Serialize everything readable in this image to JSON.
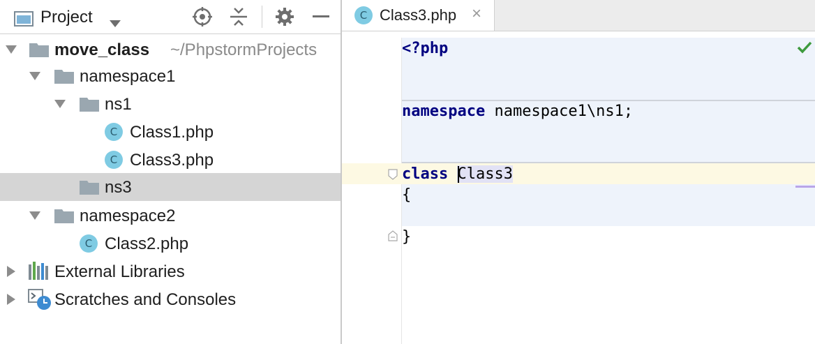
{
  "project_panel": {
    "title": "Project",
    "tree": [
      {
        "label": "move_class",
        "path": "~/PhpstormProjects",
        "type": "root-folder",
        "expanded": true
      },
      {
        "label": "namespace1",
        "type": "folder",
        "expanded": true
      },
      {
        "label": "ns1",
        "type": "folder",
        "expanded": true
      },
      {
        "label": "Class1.php",
        "type": "php-class"
      },
      {
        "label": "Class3.php",
        "type": "php-class"
      },
      {
        "label": "ns3",
        "type": "folder",
        "selected": true
      },
      {
        "label": "namespace2",
        "type": "folder",
        "expanded": true
      },
      {
        "label": "Class2.php",
        "type": "php-class"
      },
      {
        "label": "External Libraries",
        "type": "libraries",
        "expanded": false
      },
      {
        "label": "Scratches and Consoles",
        "type": "scratches",
        "expanded": false
      }
    ],
    "class_icon_letter": "C"
  },
  "editor": {
    "tab": {
      "label": "Class3.php",
      "close": "×"
    },
    "code": {
      "php_open": "<?php",
      "namespace_kw": "namespace",
      "namespace_value": " namespace1\\ns1;",
      "class_kw": "class",
      "class_name": "Class3",
      "open_brace": "{",
      "close_brace": "}"
    }
  },
  "colors": {
    "selection": "#d5d5d5",
    "keyword": "#000080",
    "class_icon": "#7fcbe3",
    "caret_row": "#fdf9e3",
    "check": "#3d9a3d"
  }
}
